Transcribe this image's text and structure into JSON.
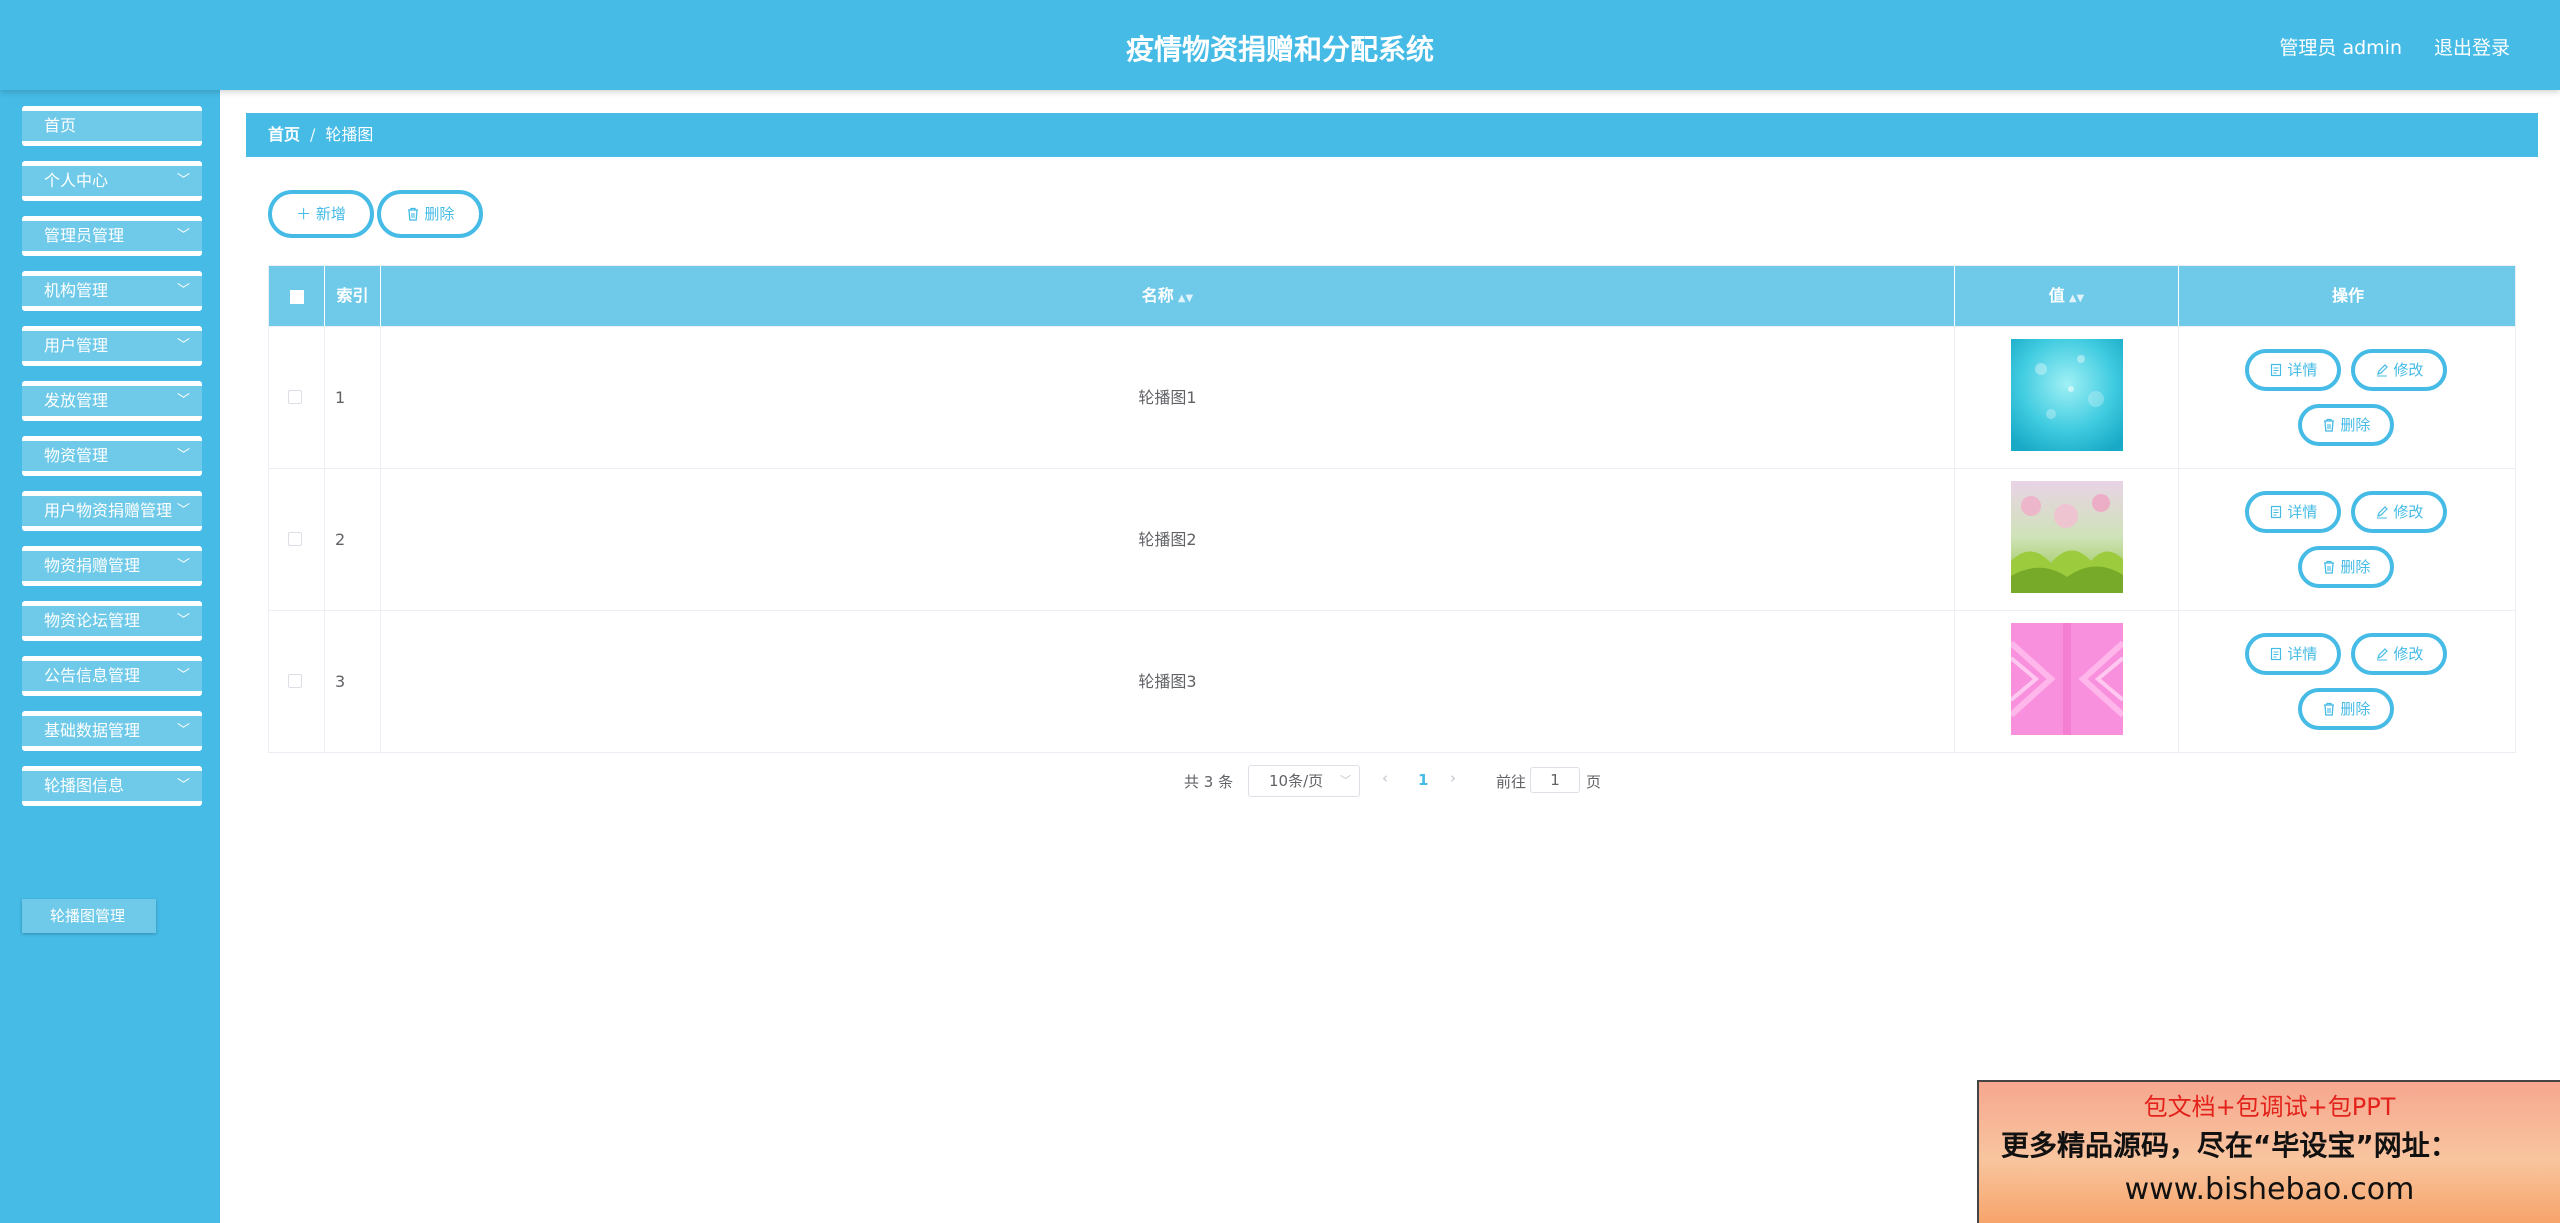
{
  "header": {
    "title": "疫情物资捐赠和分配系统",
    "user_label": "管理员 admin",
    "logout_label": "退出登录"
  },
  "sidebar": {
    "items": [
      {
        "label": "首页",
        "has_chevron": false
      },
      {
        "label": "个人中心",
        "has_chevron": true
      },
      {
        "label": "管理员管理",
        "has_chevron": true
      },
      {
        "label": "机构管理",
        "has_chevron": true
      },
      {
        "label": "用户管理",
        "has_chevron": true
      },
      {
        "label": "发放管理",
        "has_chevron": true
      },
      {
        "label": "物资管理",
        "has_chevron": true
      },
      {
        "label": "用户物资捐赠管理",
        "has_chevron": true
      },
      {
        "label": "物资捐赠管理",
        "has_chevron": true
      },
      {
        "label": "物资论坛管理",
        "has_chevron": true
      },
      {
        "label": "公告信息管理",
        "has_chevron": true
      },
      {
        "label": "基础数据管理",
        "has_chevron": true
      },
      {
        "label": "轮播图信息",
        "has_chevron": true
      }
    ],
    "submenu": {
      "label": "轮播图管理"
    }
  },
  "breadcrumb": {
    "home": "首页",
    "separator": "/",
    "current": "轮播图"
  },
  "toolbar": {
    "add_label": "新增",
    "delete_label": "删除"
  },
  "table": {
    "columns": [
      "索引",
      "名称",
      "值",
      "操作"
    ],
    "rows": [
      {
        "index": "1",
        "name": "轮播图1",
        "image": "cyan-bokeh"
      },
      {
        "index": "2",
        "name": "轮播图2",
        "image": "pink-blossom-grass"
      },
      {
        "index": "3",
        "name": "轮播图3",
        "image": "pink-geometric"
      }
    ],
    "row_actions": {
      "detail": "详情",
      "edit": "修改",
      "delete": "删除"
    }
  },
  "pagination": {
    "total": "共 3 条",
    "page_size": "10条/页",
    "current_page": "1",
    "goto_label": "前往",
    "goto_value": "1",
    "page_suffix": "页"
  },
  "watermark": {
    "line1": "包文档+包调试+包PPT",
    "line2": "更多精品源码，尽在“毕设宝”网址：",
    "line3": "www.bishebao.com"
  },
  "colors": {
    "primary": "#45bbe6",
    "primary_light": "#6ecae8"
  }
}
